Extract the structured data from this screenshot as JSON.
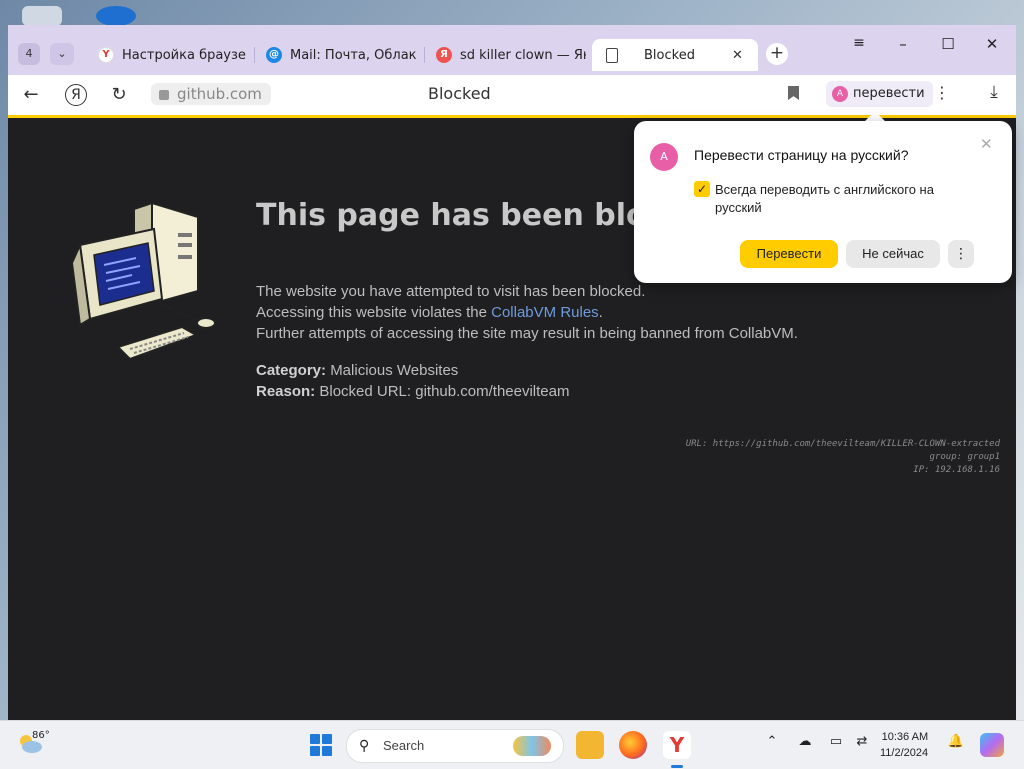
{
  "browser": {
    "tab_count": "4",
    "tabs": [
      {
        "label": "Настройка браузера",
        "favicon": "yandex-y-icon"
      },
      {
        "label": "Mail: Почта, Облако, Календарь",
        "favicon": "mail-at-icon"
      },
      {
        "label": "sd killer clown — Яндекс",
        "favicon": "yandex-ya-icon"
      },
      {
        "label": "Blocked",
        "favicon": "page-icon"
      }
    ],
    "active_tab": 3,
    "address": "github.com",
    "page_title": "Blocked",
    "translate_label": "перевести"
  },
  "page": {
    "heading": "This page has been blocked",
    "line1": "The website you have attempted to visit has been blocked.",
    "line2_prefix": "Accessing this website violates the ",
    "line2_link": "CollabVM Rules",
    "line2_suffix": ".",
    "line3": "Further attempts of accessing the site may result in being banned from CollabVM.",
    "category_label": "Category:",
    "category_value": "Malicious Websites",
    "reason_label": "Reason:",
    "reason_value": "Blocked URL: github.com/theevilteam",
    "meta_url": "URL: https://github.com/theevilteam/KILLER-CLOWN-extracted",
    "meta_group": "group: group1",
    "meta_ip": "IP: 192.168.1.16"
  },
  "translate_popup": {
    "question": "Перевести страницу на русский?",
    "checkbox_label": "Всегда переводить с английского на русский",
    "checkbox_checked": true,
    "translate_button": "Перевести",
    "not_now_button": "Не сейчас"
  },
  "taskbar": {
    "temperature": "86°",
    "search_placeholder": "Search",
    "time": "10:36 AM",
    "date": "11/2/2024"
  },
  "colors": {
    "accent_yellow": "#ffcc00",
    "page_bg": "#1f1f21",
    "link": "#6f9bdc",
    "tabbar_bg": "#dcd3ee"
  }
}
